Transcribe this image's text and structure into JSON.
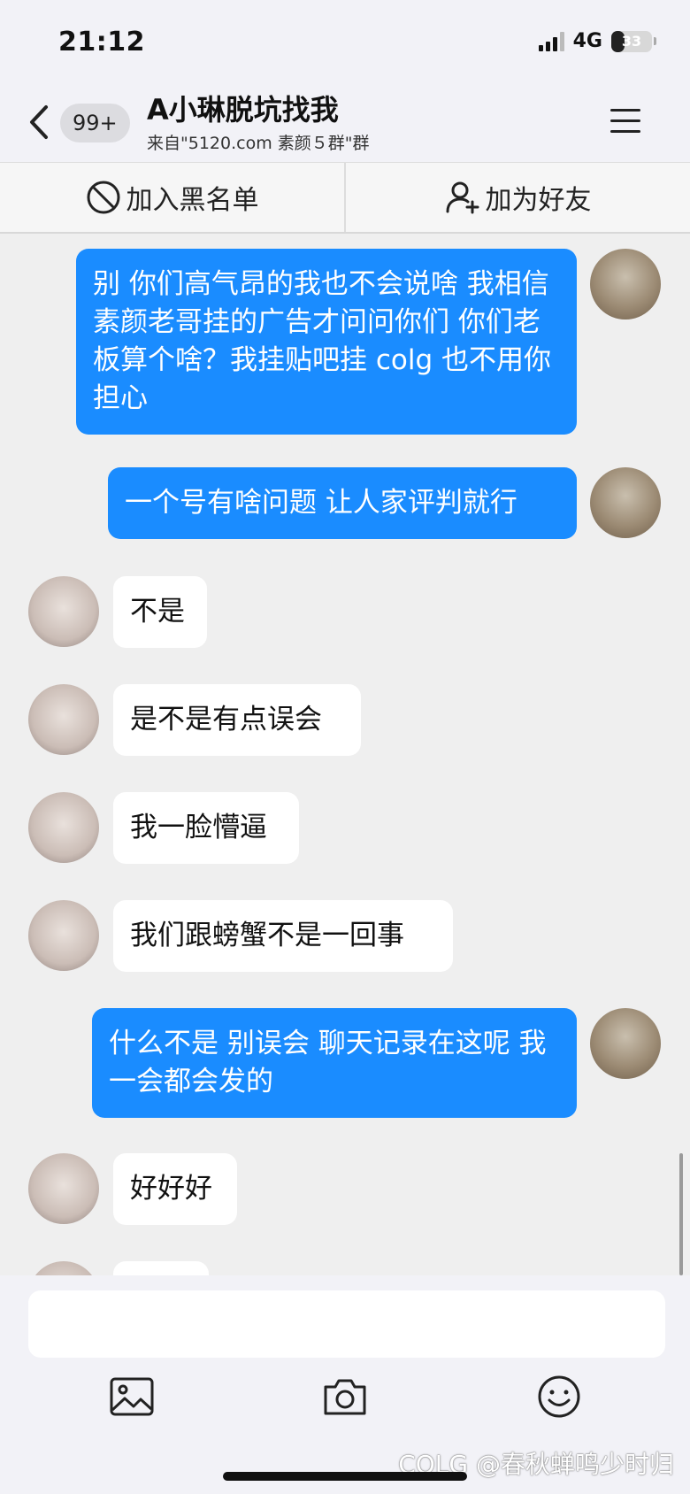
{
  "status_bar": {
    "time": "21:12",
    "network": "4G",
    "battery_level": "33",
    "battery_fraction": 0.33
  },
  "nav": {
    "unread_badge": "99+",
    "title": "A小琳脱坑找我",
    "subtitle": "来自\"5120.com 素颜５群\"群"
  },
  "actions": {
    "blacklist_label": "加入黑名单",
    "add_friend_label": "加为好友"
  },
  "messages": [
    {
      "sender": "me",
      "text": "别 你们高气昂的我也不会说啥 我相信素颜老哥挂的广告才问问你们 你们老板算个啥？我挂贴吧挂 colg 也不用你担心"
    },
    {
      "sender": "me",
      "text": "一个号有啥问题 让人家评判就行"
    },
    {
      "sender": "other",
      "text": "不是"
    },
    {
      "sender": "other",
      "text": "是不是有点误会"
    },
    {
      "sender": "other",
      "text": "我一脸懵逼"
    },
    {
      "sender": "other",
      "text": "我们跟螃蟹不是一回事"
    },
    {
      "sender": "me",
      "text": "什么不是 别误会 聊天记录在这呢 我一会都会发的"
    },
    {
      "sender": "other",
      "text": "好好好"
    },
    {
      "sender": "other",
      "text": ""
    }
  ],
  "composer": {
    "placeholder": ""
  },
  "toolbar_icons": [
    "image-icon",
    "camera-icon",
    "emoji-icon"
  ],
  "watermark": "COLG @春秋蝉鸣少时归",
  "colors": {
    "accent_blue": "#1a8cff",
    "bubble_other": "#ffffff",
    "background": "#efefef"
  }
}
